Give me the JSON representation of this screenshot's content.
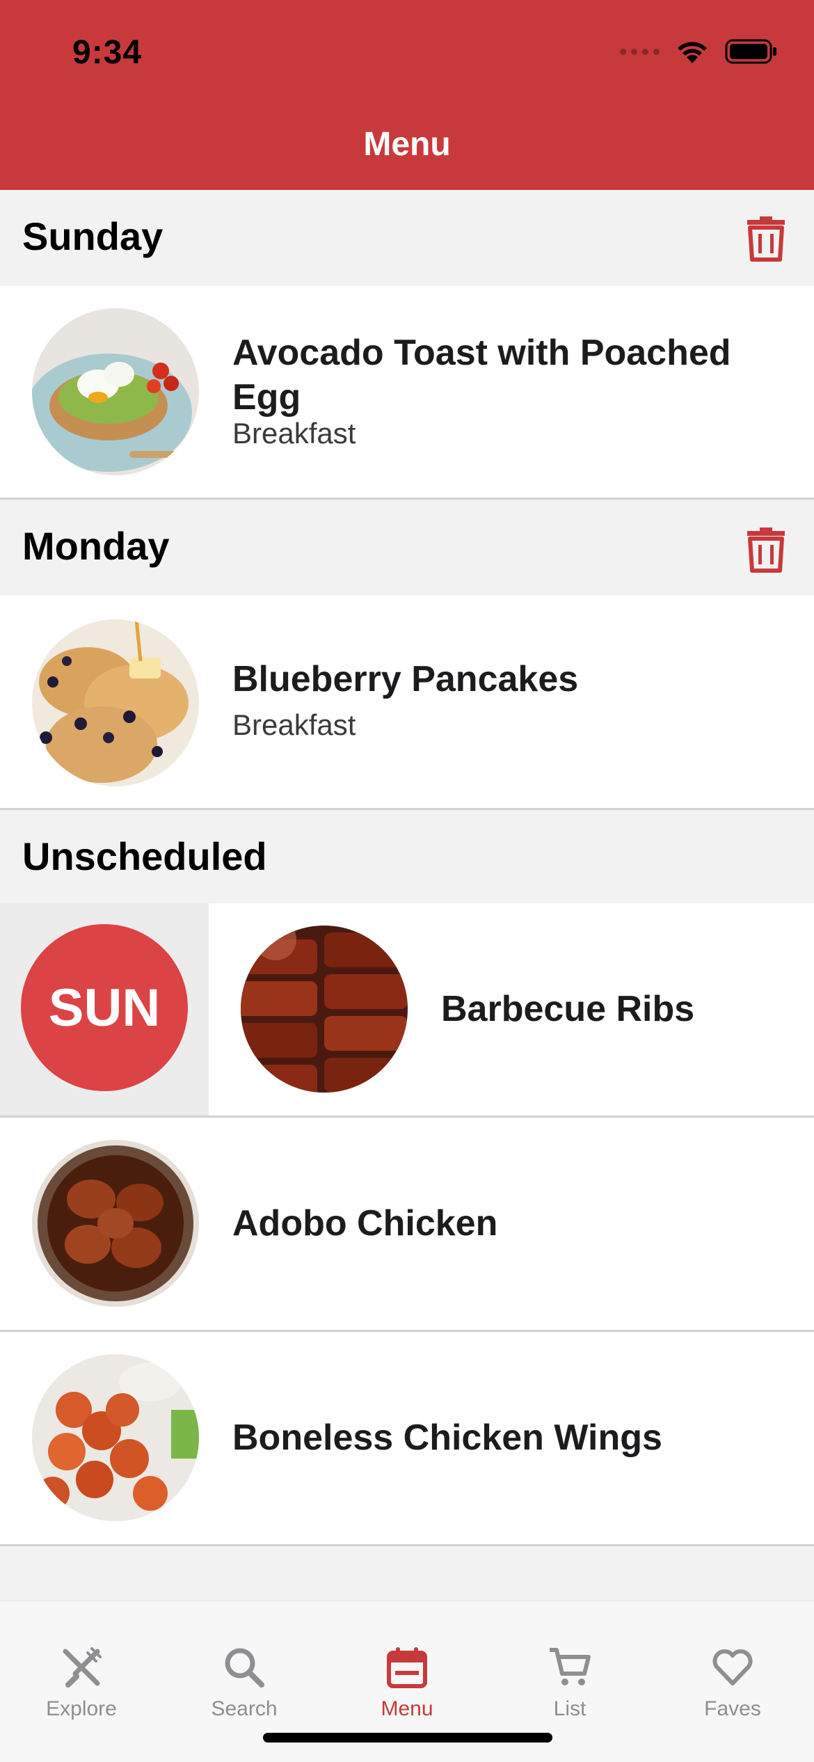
{
  "status_bar": {
    "time": "9:34"
  },
  "header": {
    "title": "Menu"
  },
  "sections": [
    {
      "title": "Sunday",
      "items": [
        {
          "title": "Avocado Toast with Poached Egg",
          "category": "Breakfast"
        }
      ]
    },
    {
      "title": "Monday",
      "items": [
        {
          "title": "Blueberry Pancakes",
          "category": "Breakfast"
        }
      ]
    },
    {
      "title": "Unscheduled",
      "items": [
        {
          "title": "Barbecue Ribs",
          "category": "",
          "swipe_action_label": "SUN"
        },
        {
          "title": "Adobo Chicken",
          "category": ""
        },
        {
          "title": "Boneless Chicken Wings",
          "category": ""
        }
      ]
    }
  ],
  "tabs": [
    {
      "label": "Explore",
      "icon": "fork-knife-icon"
    },
    {
      "label": "Search",
      "icon": "search-icon"
    },
    {
      "label": "Menu",
      "icon": "calendar-icon",
      "active": true
    },
    {
      "label": "List",
      "icon": "cart-icon"
    },
    {
      "label": "Faves",
      "icon": "heart-icon"
    }
  ],
  "colors": {
    "accent": "#c8393b",
    "swipe_action": "#dc4345",
    "section_bg": "#f2f2f2",
    "inactive_tab": "#8e8e93"
  }
}
